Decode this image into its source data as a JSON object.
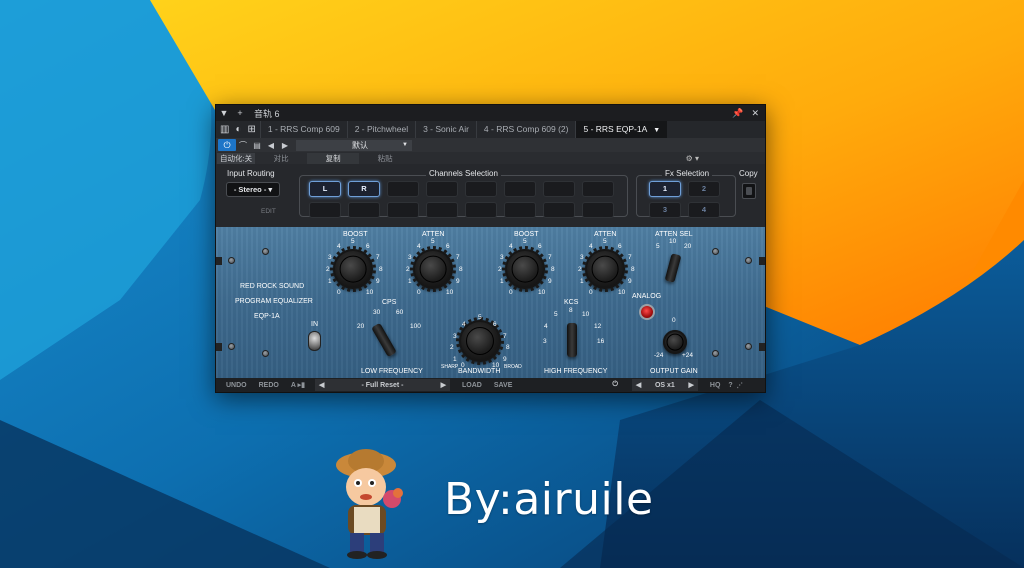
{
  "window": {
    "title": "音轨 6",
    "tabs": [
      {
        "label": "1 - RRS Comp 609",
        "active": false
      },
      {
        "label": "2 - Pitchwheel",
        "active": false
      },
      {
        "label": "3 - Sonic Air",
        "active": false
      },
      {
        "label": "4 - RRS Comp 609 (2)",
        "active": false
      },
      {
        "label": "5 - RRS EQP-1A",
        "active": true
      }
    ],
    "preset_name": "默认",
    "automation": {
      "toggle": "自动化:关",
      "compare": "对比",
      "copy": "复制",
      "paste": "粘贴"
    }
  },
  "routing": {
    "input_routing_label": "Input Routing",
    "input_routing_value": "- Stereo -",
    "edit_label": "EDIT",
    "channels_label": "Channels Selection",
    "channels": [
      "L",
      "R"
    ],
    "fx_label": "Fx Selection",
    "fx_buttons": [
      "1",
      "2",
      "3",
      "4"
    ],
    "copy_label": "Copy"
  },
  "eq": {
    "brand": [
      "RED ROCK SOUND",
      "PROGRAM EQUALIZER",
      "EQP-1A"
    ],
    "boost_label": "BOOST",
    "atten_label": "ATTEN",
    "atten_sel_label": "ATTEN SEL",
    "atten_sel_ticks": [
      "5",
      "10",
      "20"
    ],
    "in_label": "IN",
    "cps_label": "CPS",
    "cps_ticks": [
      "20",
      "30",
      "60",
      "100"
    ],
    "low_freq_label": "LOW FREQUENCY",
    "bandwidth_label": "BANDWIDTH",
    "sharp_label": "SHARP",
    "broad_label": "BROAD",
    "kcs_label": "KCS",
    "kcs_ticks": [
      "3",
      "4",
      "5",
      "8",
      "10",
      "12",
      "16"
    ],
    "high_freq_label": "HIGH FREQUENCY",
    "analog_label": "ANALOG",
    "output_gain_label": "OUTPUT GAIN",
    "output_ticks": [
      "-24",
      "0",
      "+24"
    ],
    "dial_ticks": [
      "0",
      "1",
      "2",
      "3",
      "4",
      "5",
      "6",
      "7",
      "8",
      "9",
      "10"
    ]
  },
  "bottom_bar": {
    "undo": "UNDO",
    "redo": "REDO",
    "a_label": "A",
    "preset": "- Full Reset -",
    "load": "LOAD",
    "save": "SAVE",
    "os": "OS x1",
    "hq": "HQ",
    "help": "?"
  },
  "watermark": {
    "byline": "By:airuile"
  }
}
